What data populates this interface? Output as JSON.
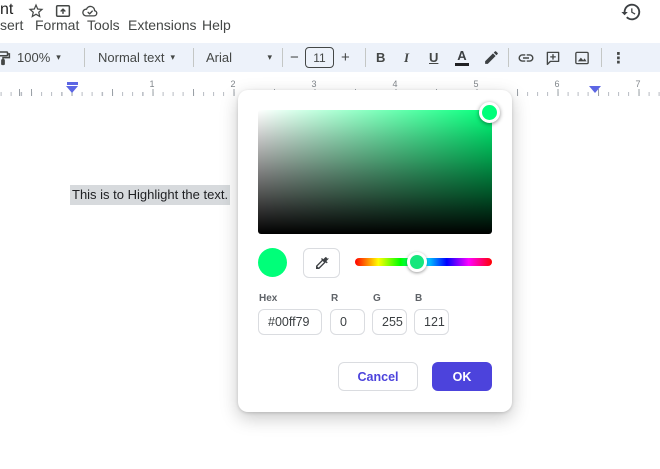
{
  "header": {
    "title_fragment": "nt",
    "menus": [
      "sert",
      "Format",
      "Tools",
      "Extensions",
      "Help"
    ]
  },
  "toolbar": {
    "zoom_value": "100%",
    "style_value": "Normal text",
    "font_value": "Arial",
    "font_size_value": "11",
    "minus_label": "−",
    "plus_label": "+",
    "bold_label": "B",
    "italic_label": "I",
    "underline_label": "U",
    "text_color_label": "A",
    "more_label": "⋮",
    "dropdown_glyph": "▾"
  },
  "ruler": {
    "numbers": [
      "1",
      "2",
      "3",
      "4",
      "5",
      "6",
      "7"
    ]
  },
  "document": {
    "highlighted_text": "This is to Highlight the text."
  },
  "color_picker": {
    "hex_label": "Hex",
    "r_label": "R",
    "g_label": "G",
    "b_label": "B",
    "hex_value": "#00ff79",
    "r_value": "0",
    "g_value": "255",
    "b_value": "121",
    "cancel_label": "Cancel",
    "ok_label": "OK",
    "selected_color": "#00ff79",
    "accent_color": "#4c43dc"
  }
}
